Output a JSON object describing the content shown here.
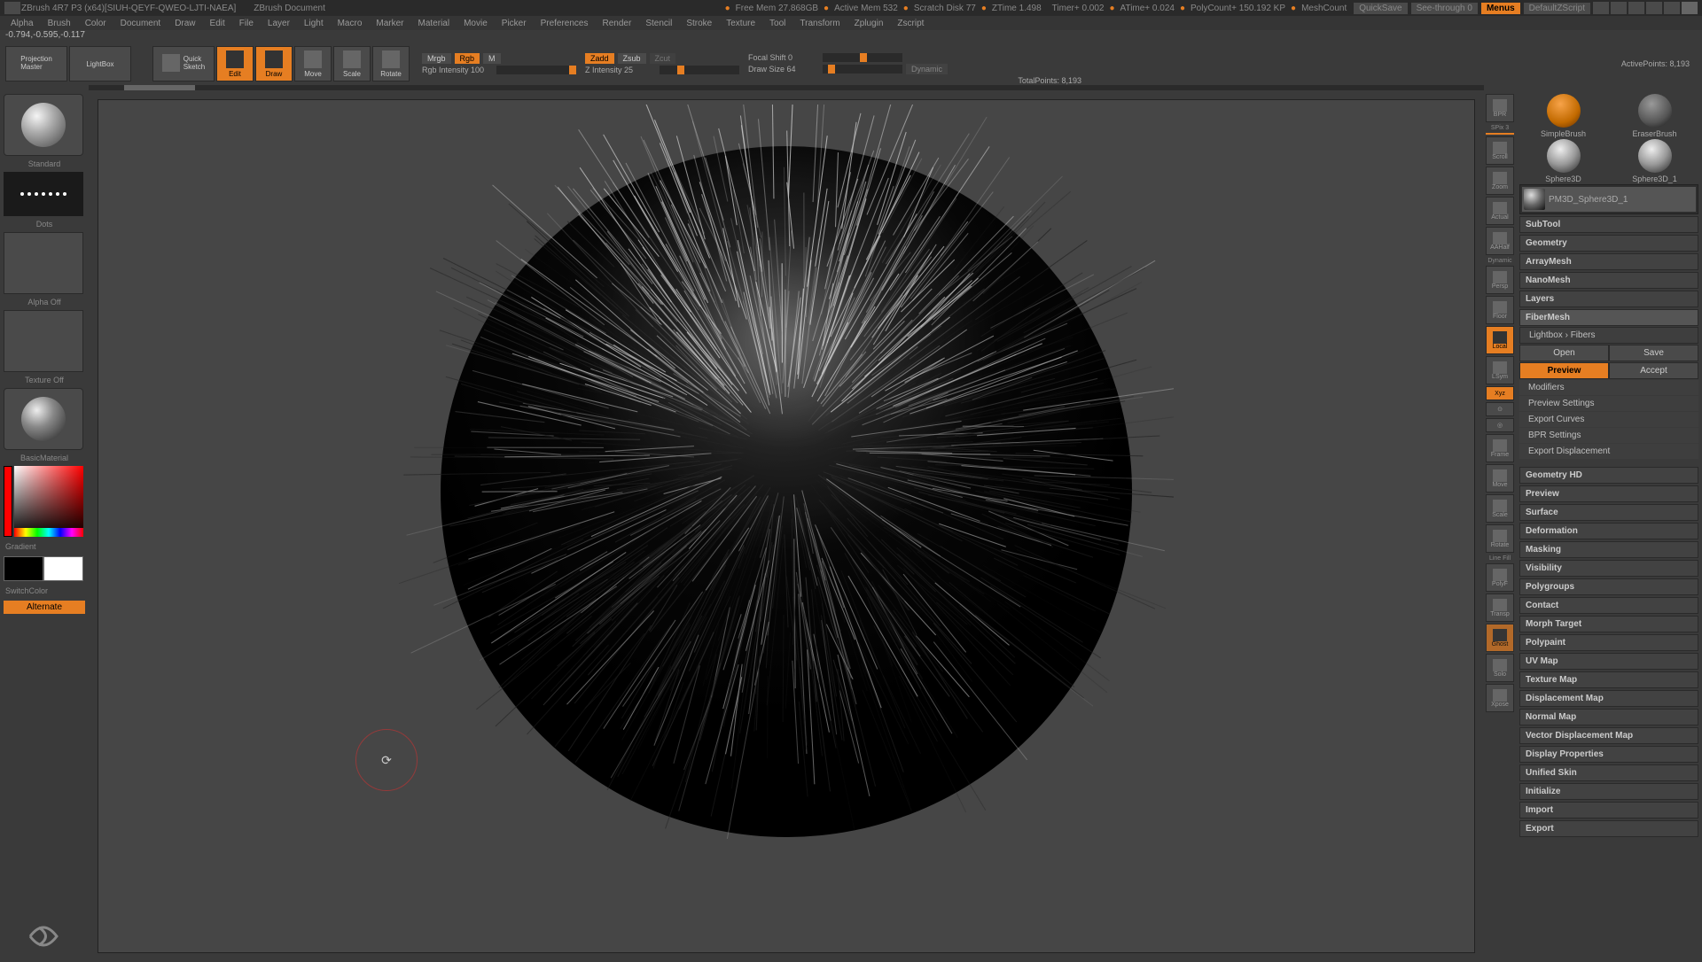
{
  "title_bar": {
    "app": "ZBrush 4R7 P3 (x64)[SIUH-QEYF-QWEO-LJTI-NAEA]",
    "doc": "ZBrush Document",
    "free_mem": "Free Mem 27.868GB",
    "active_mem": "Active Mem 532",
    "scratch": "Scratch Disk 77",
    "ztime": "ZTime 1.498",
    "timer": "Timer+ 0.002",
    "atime": "ATime+ 0.024",
    "polycount": "PolyCount+ 150.192 KP",
    "meshcount": "MeshCount",
    "quicksave": "QuickSave",
    "seethrough": "See-through   0",
    "menus": "Menus",
    "palette": "DefaultZScript"
  },
  "menu": [
    "Alpha",
    "Brush",
    "Color",
    "Document",
    "Draw",
    "Edit",
    "File",
    "Layer",
    "Light",
    "Macro",
    "Marker",
    "Material",
    "Movie",
    "Picker",
    "Preferences",
    "Render",
    "Stencil",
    "Stroke",
    "Texture",
    "Tool",
    "Transform",
    "Zplugin",
    "Zscript"
  ],
  "coords": "-0.794,-0.595,-0.117",
  "toolbar": {
    "proj_master": "Projection\nMaster",
    "lightbox": "LightBox",
    "quicksketch": "Quick\nSketch",
    "edit": "Edit",
    "draw_mode": "Draw",
    "move": "Move",
    "scale": "Scale",
    "rotate": "Rotate",
    "mrgb": "Mrgb",
    "rgb": "Rgb",
    "m": "M",
    "rgb_intensity_lbl": "Rgb Intensity",
    "rgb_intensity_val": "100",
    "zadd": "Zadd",
    "zsub": "Zsub",
    "zcut": "Zcut",
    "z_intensity_lbl": "Z Intensity",
    "z_intensity_val": "25",
    "focal_shift_lbl": "Focal Shift",
    "focal_shift_val": "0",
    "draw_size_lbl": "Draw Size",
    "draw_size_val": "64",
    "dynamic": "Dynamic",
    "active_pts_lbl": "ActivePoints:",
    "active_pts_val": "8,193",
    "total_pts_lbl": "TotalPoints:",
    "total_pts_val": "8,193"
  },
  "left": {
    "brush_name": "Standard",
    "stroke_name": "Dots",
    "alpha_off": "Alpha  Off",
    "texture_off": "Texture  Off",
    "material": "BasicMaterial",
    "gradient": "Gradient",
    "switch_color": "SwitchColor",
    "alternate": "Alternate"
  },
  "right_icons": {
    "bpr": "BPR",
    "spix": "SPix 3",
    "scroll": "Scroll",
    "zoom": "Zoom",
    "actual": "Actual",
    "aahalf": "AAHalf",
    "persp_top": "Dynamic",
    "persp": "Persp",
    "floor": "Floor",
    "local": "Local",
    "lsym": "LSym",
    "xyz": "Xyz",
    "frame": "Frame",
    "move2": "Move",
    "scale2": "Scale",
    "rotate2": "Rotate",
    "linefill": "Line Fill",
    "polyf": "PolyF",
    "transp": "Transp",
    "ghost": "Ghost",
    "solo": "Solo",
    "xpose": "Xpose"
  },
  "right_panel": {
    "brushes": {
      "simple": "SimpleBrush",
      "eraser": "EraserBrush",
      "sphere": "Sphere3D",
      "sphere1": "Sphere3D_1",
      "pm3d": "PM3D_Sphere3D_1"
    },
    "subtool": "SubTool",
    "geometry": "Geometry",
    "arraymesh": "ArrayMesh",
    "nanomesh": "NanoMesh",
    "layers": "Layers",
    "fibermesh": "FiberMesh",
    "lightbox_fibers": "Lightbox › Fibers",
    "open": "Open",
    "save": "Save",
    "preview": "Preview",
    "accept": "Accept",
    "modifiers": "Modifiers",
    "preview_settings": "Preview Settings",
    "export_curves": "Export Curves",
    "bpr_settings": "BPR Settings",
    "export_disp": "Export Displacement",
    "geometry_hd": "Geometry HD",
    "preview2": "Preview",
    "surface": "Surface",
    "deformation": "Deformation",
    "masking": "Masking",
    "visibility": "Visibility",
    "polygroups": "Polygroups",
    "contact": "Contact",
    "morph_target": "Morph Target",
    "polypaint": "Polypaint",
    "uv_map": "UV Map",
    "texture_map": "Texture Map",
    "displacement_map": "Displacement Map",
    "normal_map": "Normal Map",
    "vector_disp": "Vector Displacement Map",
    "display_props": "Display Properties",
    "unified_skin": "Unified Skin",
    "initialize": "Initialize",
    "import": "Import",
    "export": "Export"
  }
}
